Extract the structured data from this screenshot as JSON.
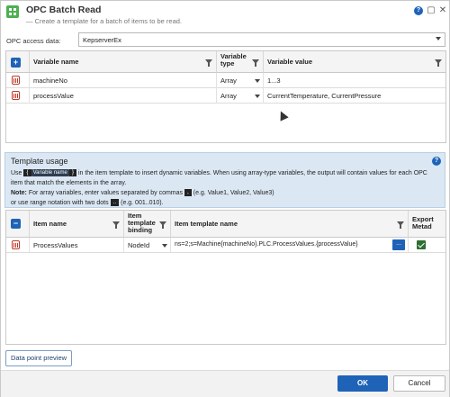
{
  "window": {
    "title": "OPC Batch Read",
    "subtitle": "— Create a template for a batch of items to be read."
  },
  "access": {
    "label": "OPC access data:",
    "value": "KepserverEx"
  },
  "variables": {
    "headers": [
      "Variable name",
      "Variable type",
      "Variable value"
    ],
    "rows": [
      {
        "name": "machineNo",
        "type": "Array",
        "value": "1...3"
      },
      {
        "name": "processValue",
        "type": "Array",
        "value": "CurrentTemperature, CurrentPressure"
      }
    ]
  },
  "usage": {
    "title": "Template usage",
    "line1a": "Use",
    "chip1": "{",
    "chip2": "Variable name",
    "chip3": "}",
    "line1b": "in the item template to insert dynamic variables. When using array-type variables, the output will contain values for each OPC item that match the elements in the array.",
    "note_label": "Note:",
    "note_a": "For array variables, enter values separated by commas",
    "comma_chip": ",",
    "note_b": "(e.g. Value1, Value2, Value3)",
    "note_c": "or use range notation with two dots",
    "dots_chip": "..",
    "note_d": "(e.g. 001..010)."
  },
  "items": {
    "headers": [
      "Item name",
      "Item template binding",
      "Item template name",
      "Export Metad"
    ],
    "rows": [
      {
        "name": "ProcessValues",
        "binding": "NodeId",
        "template": "ns=2;s=Machine{machineNo}.PLC.ProcessValues.{processValue}",
        "export": true
      }
    ],
    "ellipsis": "..."
  },
  "buttons": {
    "preview": "Data point preview",
    "ok": "OK",
    "cancel": "Cancel"
  },
  "colors": {
    "accent": "#1e63b7",
    "panel": "#dbe8f4"
  }
}
